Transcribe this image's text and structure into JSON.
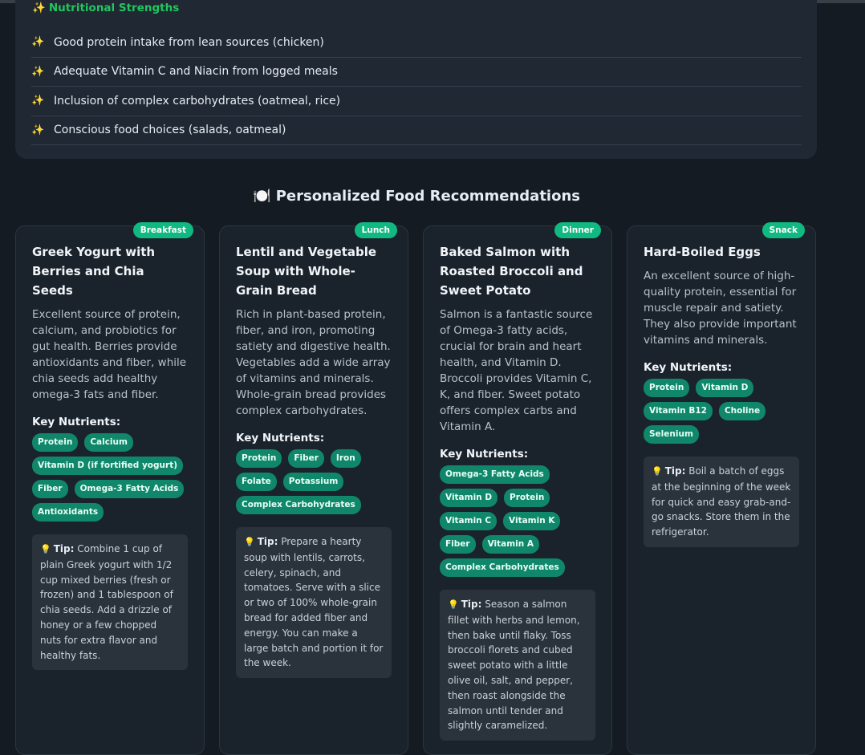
{
  "strengths": {
    "title": "Nutritional Strengths",
    "items": [
      "Good protein intake from lean sources (chicken)",
      "Adequate Vitamin C and Niacin from logged meals",
      "Inclusion of complex carbohydrates (oatmeal, rice)",
      "Conscious food choices (salads, oatmeal)"
    ]
  },
  "recommendations": {
    "title": "Personalized Food Recommendations",
    "key_nutrients_label": "Key Nutrients:",
    "tip_label": "Tip:",
    "cards": [
      {
        "badge": "Breakfast",
        "title": "Greek Yogurt with Berries and Chia Seeds",
        "description": "Excellent source of protein, calcium, and probiotics for gut health. Berries provide antioxidants and fiber, while chia seeds add healthy omega-3 fats and fiber.",
        "nutrients": [
          "Protein",
          "Calcium",
          "Vitamin D (if fortified yogurt)",
          "Fiber",
          "Omega-3 Fatty Acids",
          "Antioxidants"
        ],
        "tip": "Combine 1 cup of plain Greek yogurt with 1/2 cup mixed berries (fresh or frozen) and 1 tablespoon of chia seeds. Add a drizzle of honey or a few chopped nuts for extra flavor and healthy fats."
      },
      {
        "badge": "Lunch",
        "title": "Lentil and Vegetable Soup with Whole-Grain Bread",
        "description": "Rich in plant-based protein, fiber, and iron, promoting satiety and digestive health. Vegetables add a wide array of vitamins and minerals. Whole-grain bread provides complex carbohydrates.",
        "nutrients": [
          "Protein",
          "Fiber",
          "Iron",
          "Folate",
          "Potassium",
          "Complex Carbohydrates"
        ],
        "tip": "Prepare a hearty soup with lentils, carrots, celery, spinach, and tomatoes. Serve with a slice or two of 100% whole-grain bread for added fiber and energy. You can make a large batch and portion it for the week."
      },
      {
        "badge": "Dinner",
        "title": "Baked Salmon with Roasted Broccoli and Sweet Potato",
        "description": "Salmon is a fantastic source of Omega-3 fatty acids, crucial for brain and heart health, and Vitamin D. Broccoli provides Vitamin C, K, and fiber. Sweet potato offers complex carbs and Vitamin A.",
        "nutrients": [
          "Omega-3 Fatty Acids",
          "Vitamin D",
          "Protein",
          "Vitamin C",
          "Vitamin K",
          "Fiber",
          "Vitamin A",
          "Complex Carbohydrates"
        ],
        "tip": "Season a salmon fillet with herbs and lemon, then bake until flaky. Toss broccoli florets and cubed sweet potato with a little olive oil, salt, and pepper, then roast alongside the salmon until tender and slightly caramelized."
      },
      {
        "badge": "Snack",
        "title": "Hard-Boiled Eggs",
        "description": "An excellent source of high-quality protein, essential for muscle repair and satiety. They also provide important vitamins and minerals.",
        "nutrients": [
          "Protein",
          "Vitamin D",
          "Vitamin B12",
          "Choline",
          "Selenium"
        ],
        "tip": "Boil a batch of eggs at the beginning of the week for quick and easy grab-and-go snacks. Store them in the refrigerator."
      }
    ]
  },
  "icons": {
    "sparkle": "sparkles-icon",
    "plate": "plate-cutlery-icon",
    "bulb": "lightbulb-icon"
  },
  "colors": {
    "accent_green": "#22c55e",
    "badge_green": "#10b981",
    "tag_green": "#10876a",
    "background": "#141b22",
    "card": "#1a222b"
  }
}
